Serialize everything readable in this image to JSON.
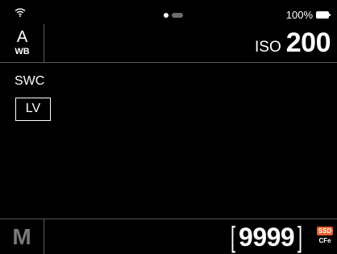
{
  "status": {
    "battery_text": "100%",
    "battery_level": 1.0,
    "pager": {
      "count": 2,
      "active_index": 0
    }
  },
  "topbar": {
    "wb_symbol": "A",
    "wb_label": "WB",
    "iso_label": "ISO",
    "iso_value": "200"
  },
  "main": {
    "mode_label": "SWC",
    "lv_button": "LV"
  },
  "bottombar": {
    "exposure_mode": "M",
    "shots_remaining": "9999",
    "media_primary": "SSD",
    "media_secondary": "CFe"
  },
  "colors": {
    "background": "#000000",
    "text": "#ffffff",
    "divider": "#5a5a5a",
    "media_badge": "#e8602c",
    "mode_inactive": "#7a7a7a"
  }
}
